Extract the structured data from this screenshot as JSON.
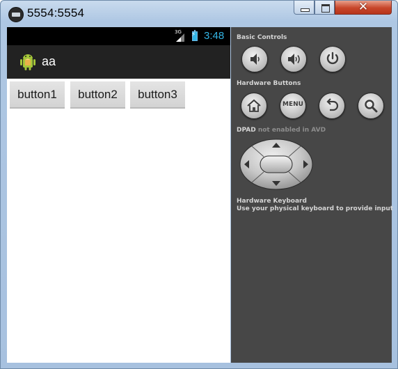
{
  "window": {
    "title": "5554:5554",
    "app_icon": "emulator-icon",
    "controls": {
      "minimize_icon": "minimize-icon",
      "maximize_icon": "maximize-icon",
      "close_glyph": "✕"
    }
  },
  "device": {
    "status_bar": {
      "network_label": "3G",
      "signal_icon": "signal-bars-icon",
      "battery_icon": "battery-charging-icon",
      "time": "3:48"
    },
    "action_bar": {
      "app_icon": "android-robot-icon",
      "title": "aa"
    },
    "buttons": [
      {
        "label": "button1"
      },
      {
        "label": "button2"
      },
      {
        "label": "button3"
      }
    ]
  },
  "controls_panel": {
    "basic_controls": {
      "heading": "Basic Controls",
      "buttons": [
        {
          "icon": "volume-down-icon"
        },
        {
          "icon": "volume-up-icon"
        },
        {
          "icon": "power-icon"
        }
      ]
    },
    "hardware_buttons": {
      "heading": "Hardware Buttons",
      "buttons": [
        {
          "icon": "home-icon"
        },
        {
          "icon": "menu-icon",
          "label": "MENU"
        },
        {
          "icon": "back-icon"
        },
        {
          "icon": "search-icon"
        }
      ]
    },
    "dpad": {
      "heading": "DPAD",
      "note": "not enabled in AVD",
      "icon": "dpad-icon"
    },
    "keyboard": {
      "heading": "Hardware Keyboard",
      "note": "Use your physical keyboard to provide input"
    }
  },
  "colors": {
    "status_bar_bg": "#000000",
    "action_bar_bg": "#222222",
    "clock": "#33b5e5",
    "panel_bg": "#474747",
    "window_frame": "#aec7e3",
    "close_button": "#c7452a"
  }
}
